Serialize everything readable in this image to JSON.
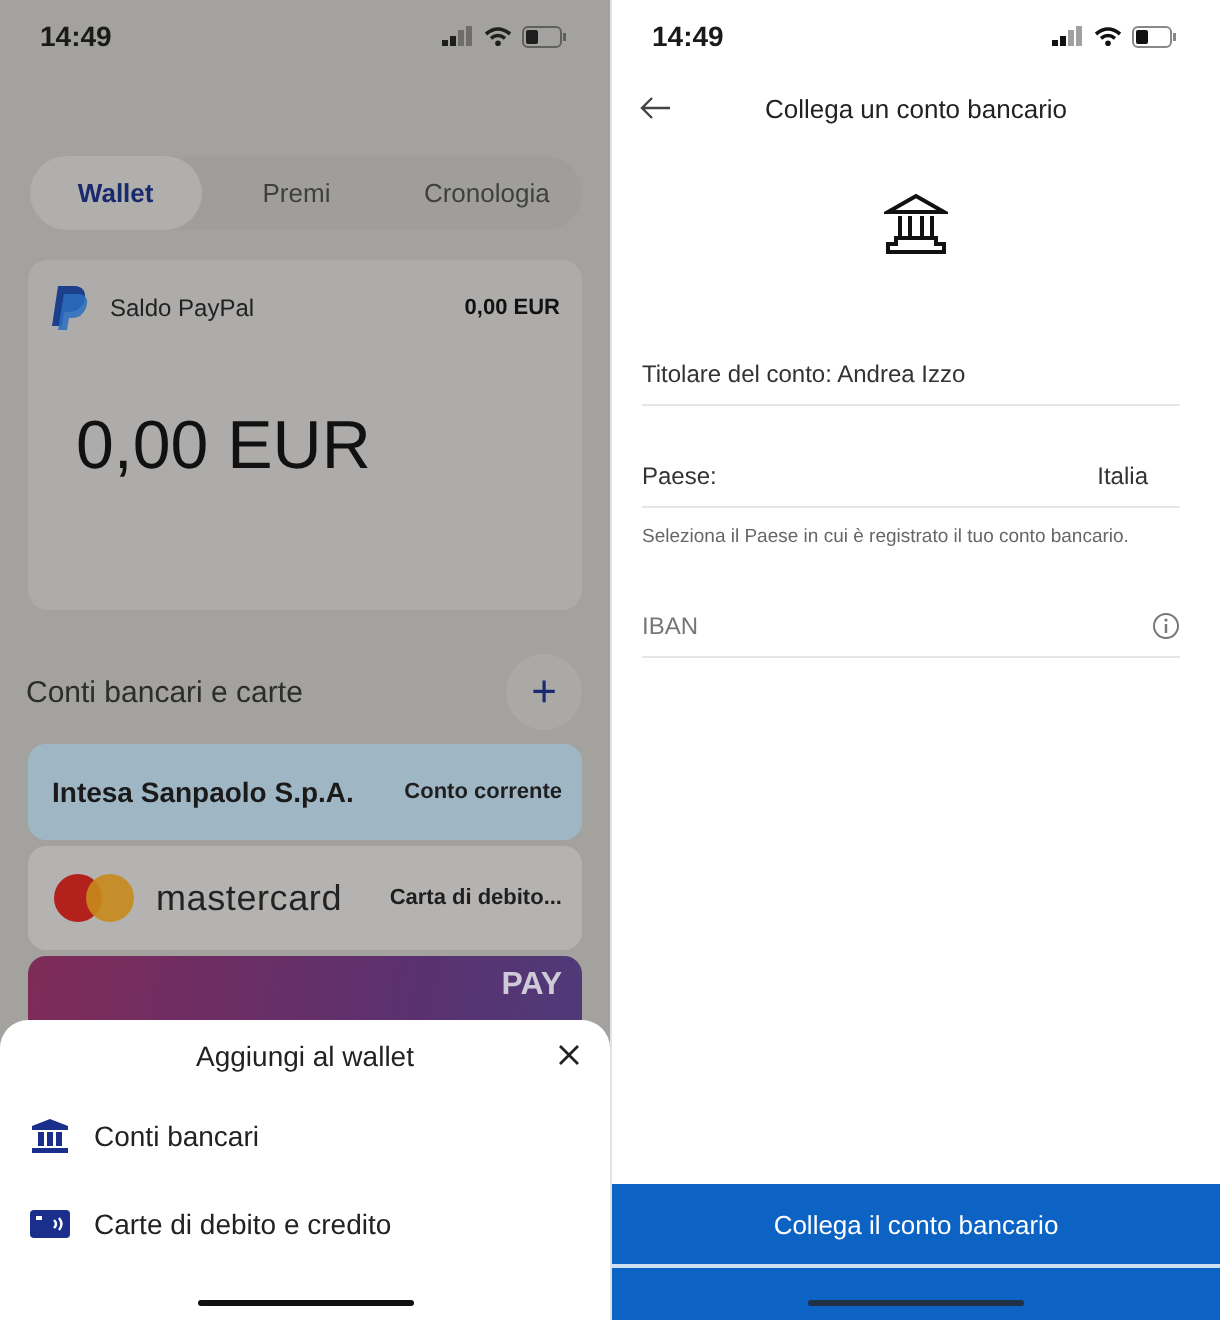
{
  "left": {
    "status_bar": {
      "time": "14:49"
    },
    "tabs": [
      {
        "label": "Wallet",
        "selected": true
      },
      {
        "label": "Premi",
        "selected": false
      },
      {
        "label": "Cronologia",
        "selected": false
      }
    ],
    "balance_card": {
      "label": "Saldo PayPal",
      "amount_small": "0,00 EUR",
      "amount": "0,00 EUR"
    },
    "section": {
      "title": "Conti bancari e carte",
      "add_button": "+"
    },
    "accounts": [
      {
        "kind": "bank",
        "name": "Intesa Sanpaolo S.p.A.",
        "type": "Conto corrente"
      },
      {
        "kind": "mastercard",
        "name": "mastercard",
        "type": "Carta di debito..."
      },
      {
        "kind": "pay",
        "name": "PAY"
      }
    ],
    "sheet": {
      "title": "Aggiungi al wallet",
      "items": [
        {
          "kind": "bank",
          "label": "Conti bancari"
        },
        {
          "kind": "card",
          "label": "Carte di debito e credito"
        }
      ]
    }
  },
  "right": {
    "status_bar": {
      "time": "14:49"
    },
    "header": {
      "title": "Collega un conto bancario"
    },
    "fields": [
      {
        "kind": "text",
        "value": "Titolare del conto: Andrea Izzo"
      },
      {
        "kind": "select",
        "label": "Paese:",
        "value": "Italia",
        "hint": "Seleziona il Paese in cui è registrato il tuo conto bancario."
      },
      {
        "kind": "input",
        "placeholder": "IBAN",
        "info": true
      }
    ],
    "primary_button": "Collega il conto bancario"
  }
}
